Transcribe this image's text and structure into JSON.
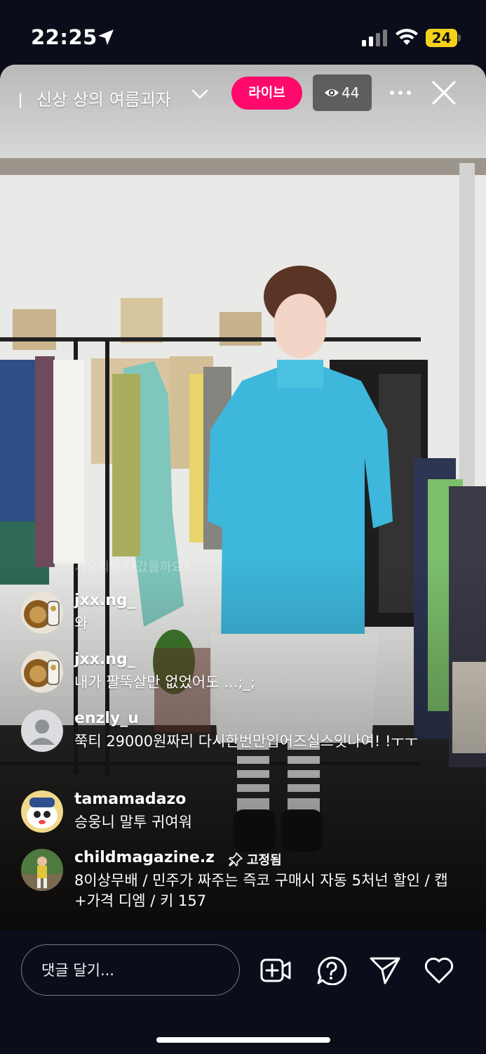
{
  "status_bar": {
    "time": "22:25",
    "battery": "24"
  },
  "live": {
    "title": "신상 상의 여름괴자",
    "live_label": "라이브",
    "viewer_count": "44"
  },
  "faded_comment": "기오리핏 나갔을까요?....",
  "comments": [
    {
      "username": "jxx.ng_",
      "text": "와",
      "avatar": "lion-avatar"
    },
    {
      "username": "jxx.ng_",
      "text": "내가 팔뚝살만 없었어도 ...;_;",
      "avatar": "lion-avatar"
    },
    {
      "username": "enzly_u",
      "text": "쭉티 29000원짜리 다시한번만입어즈실스잇나여! !ㅜㅜ",
      "avatar": "default-avatar"
    },
    {
      "username": "tamamadazo",
      "text": "승웅니 말투 귀여워",
      "avatar": "cartoon-avatar"
    },
    {
      "username": "childmagazine.z",
      "text": "8이상무배 / 민주가 짜주는 즉코 구매시 자동 5처넌 할인 / 캡+가격 디엠 / 키 157",
      "avatar": "photo-avatar",
      "pinned_label": "고정됨"
    }
  ],
  "bottom_bar": {
    "comment_placeholder": "댓글 달기..."
  },
  "colors": {
    "live_badge": "#ff0a6c",
    "background": "#0b0d1a",
    "battery": "#f4d21b"
  }
}
